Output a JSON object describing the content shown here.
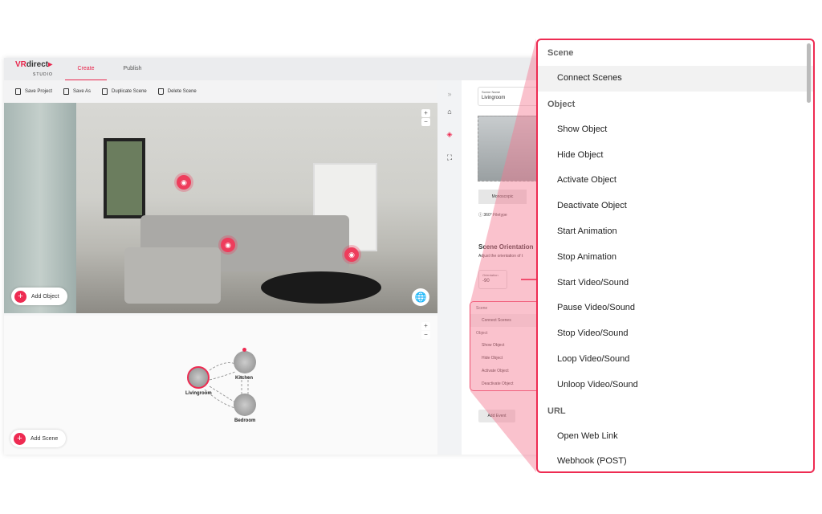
{
  "app": {
    "logo_main": "VR",
    "logo_accent": "direct",
    "logo_sub": "STUDIO"
  },
  "tabs": [
    {
      "label": "Create",
      "active": true
    },
    {
      "label": "Publish",
      "active": false
    }
  ],
  "toolbar": [
    {
      "label": "Save Project",
      "icon": "save-icon"
    },
    {
      "label": "Save As",
      "icon": "save-as-icon"
    },
    {
      "label": "Duplicate Scene",
      "icon": "duplicate-icon"
    },
    {
      "label": "Delete Scene",
      "icon": "trash-icon"
    }
  ],
  "viewport": {
    "add_object": "Add Object",
    "zoom_in": "+",
    "zoom_out": "−"
  },
  "graph": {
    "add_scene": "Add Scene",
    "nodes": [
      "Livingroom",
      "Kitchen",
      "Bedroom"
    ]
  },
  "panel": {
    "scene_name_label": "Scene Name",
    "scene_name": "Livingroom",
    "stereo": "Monoscopic",
    "filetype": "360° Filetype",
    "orientation_title": "Scene Orientation",
    "orientation_desc": "Adjust the orientation of t",
    "orientation_label": "Orientation",
    "orientation_value": "-90",
    "add_event": "Add Event"
  },
  "mini_menu": {
    "groups": [
      {
        "header": "Scene",
        "items": [
          "Connect Scenes"
        ]
      },
      {
        "header": "Object",
        "items": [
          "Show Object",
          "Hide Object",
          "Activate Object",
          "Deactivate Object"
        ]
      }
    ]
  },
  "popup_menu": {
    "groups": [
      {
        "header": "Scene",
        "items": [
          "Connect Scenes"
        ]
      },
      {
        "header": "Object",
        "items": [
          "Show Object",
          "Hide Object",
          "Activate Object",
          "Deactivate Object",
          "Start Animation",
          "Stop Animation",
          "Start Video/Sound",
          "Pause Video/Sound",
          "Stop Video/Sound",
          "Loop Video/Sound",
          "Unloop Video/Sound"
        ]
      },
      {
        "header": "URL",
        "items": [
          "Open Web Link",
          "Webhook (POST)"
        ]
      }
    ],
    "highlighted": "Connect Scenes"
  },
  "colors": {
    "accent": "#ee2b52"
  }
}
